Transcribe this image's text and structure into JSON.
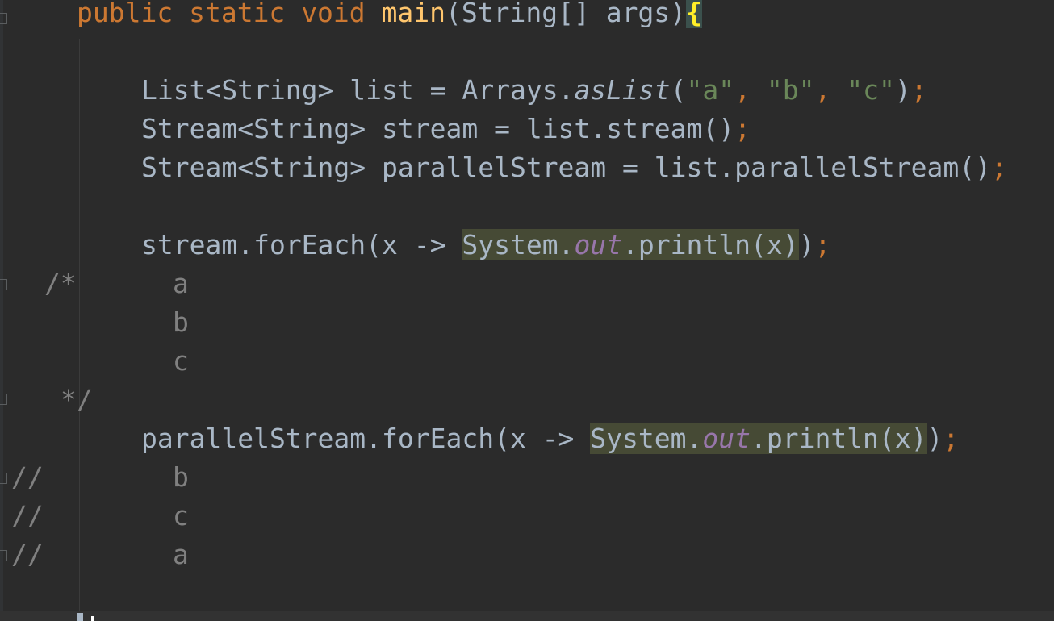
{
  "code": {
    "l1": {
      "kw1": "public",
      "kw2": "static",
      "kw3": "void",
      "method": "main",
      "params": "(String[] args)",
      "brace": "{"
    },
    "l2": {
      "a": "List<String> list = Arrays.",
      "m": "asList",
      "b": "(",
      "s1": "\"a\"",
      "c1": ", ",
      "s2": "\"b\"",
      "c2": ", ",
      "s3": "\"c\"",
      "d": ")",
      "semi": ";"
    },
    "l3": {
      "a": "Stream<String> stream = list.stream()",
      "semi": ";"
    },
    "l4": {
      "a": "Stream<String> parallelStream = list.parallelStream()",
      "semi": ";"
    },
    "l5": {
      "a": "stream.forEach(x -> ",
      "h1": "System.",
      "hf": "out",
      "h2": ".println(x)",
      "b": ")",
      "semi": ";"
    },
    "c1": {
      "open": "/*",
      "v": "a"
    },
    "c2": {
      "v": "b"
    },
    "c3": {
      "v": "c"
    },
    "c4": {
      "close": "*/"
    },
    "l6": {
      "a": "parallelStream.forEach(x -> ",
      "h1": "System.",
      "hf": "out",
      "h2": ".println(x)",
      "b": ")",
      "semi": ";"
    },
    "c5": {
      "p": "//",
      "v": "b"
    },
    "c6": {
      "p": "//",
      "v": "c"
    },
    "c7": {
      "p": "//",
      "v": "a"
    }
  }
}
